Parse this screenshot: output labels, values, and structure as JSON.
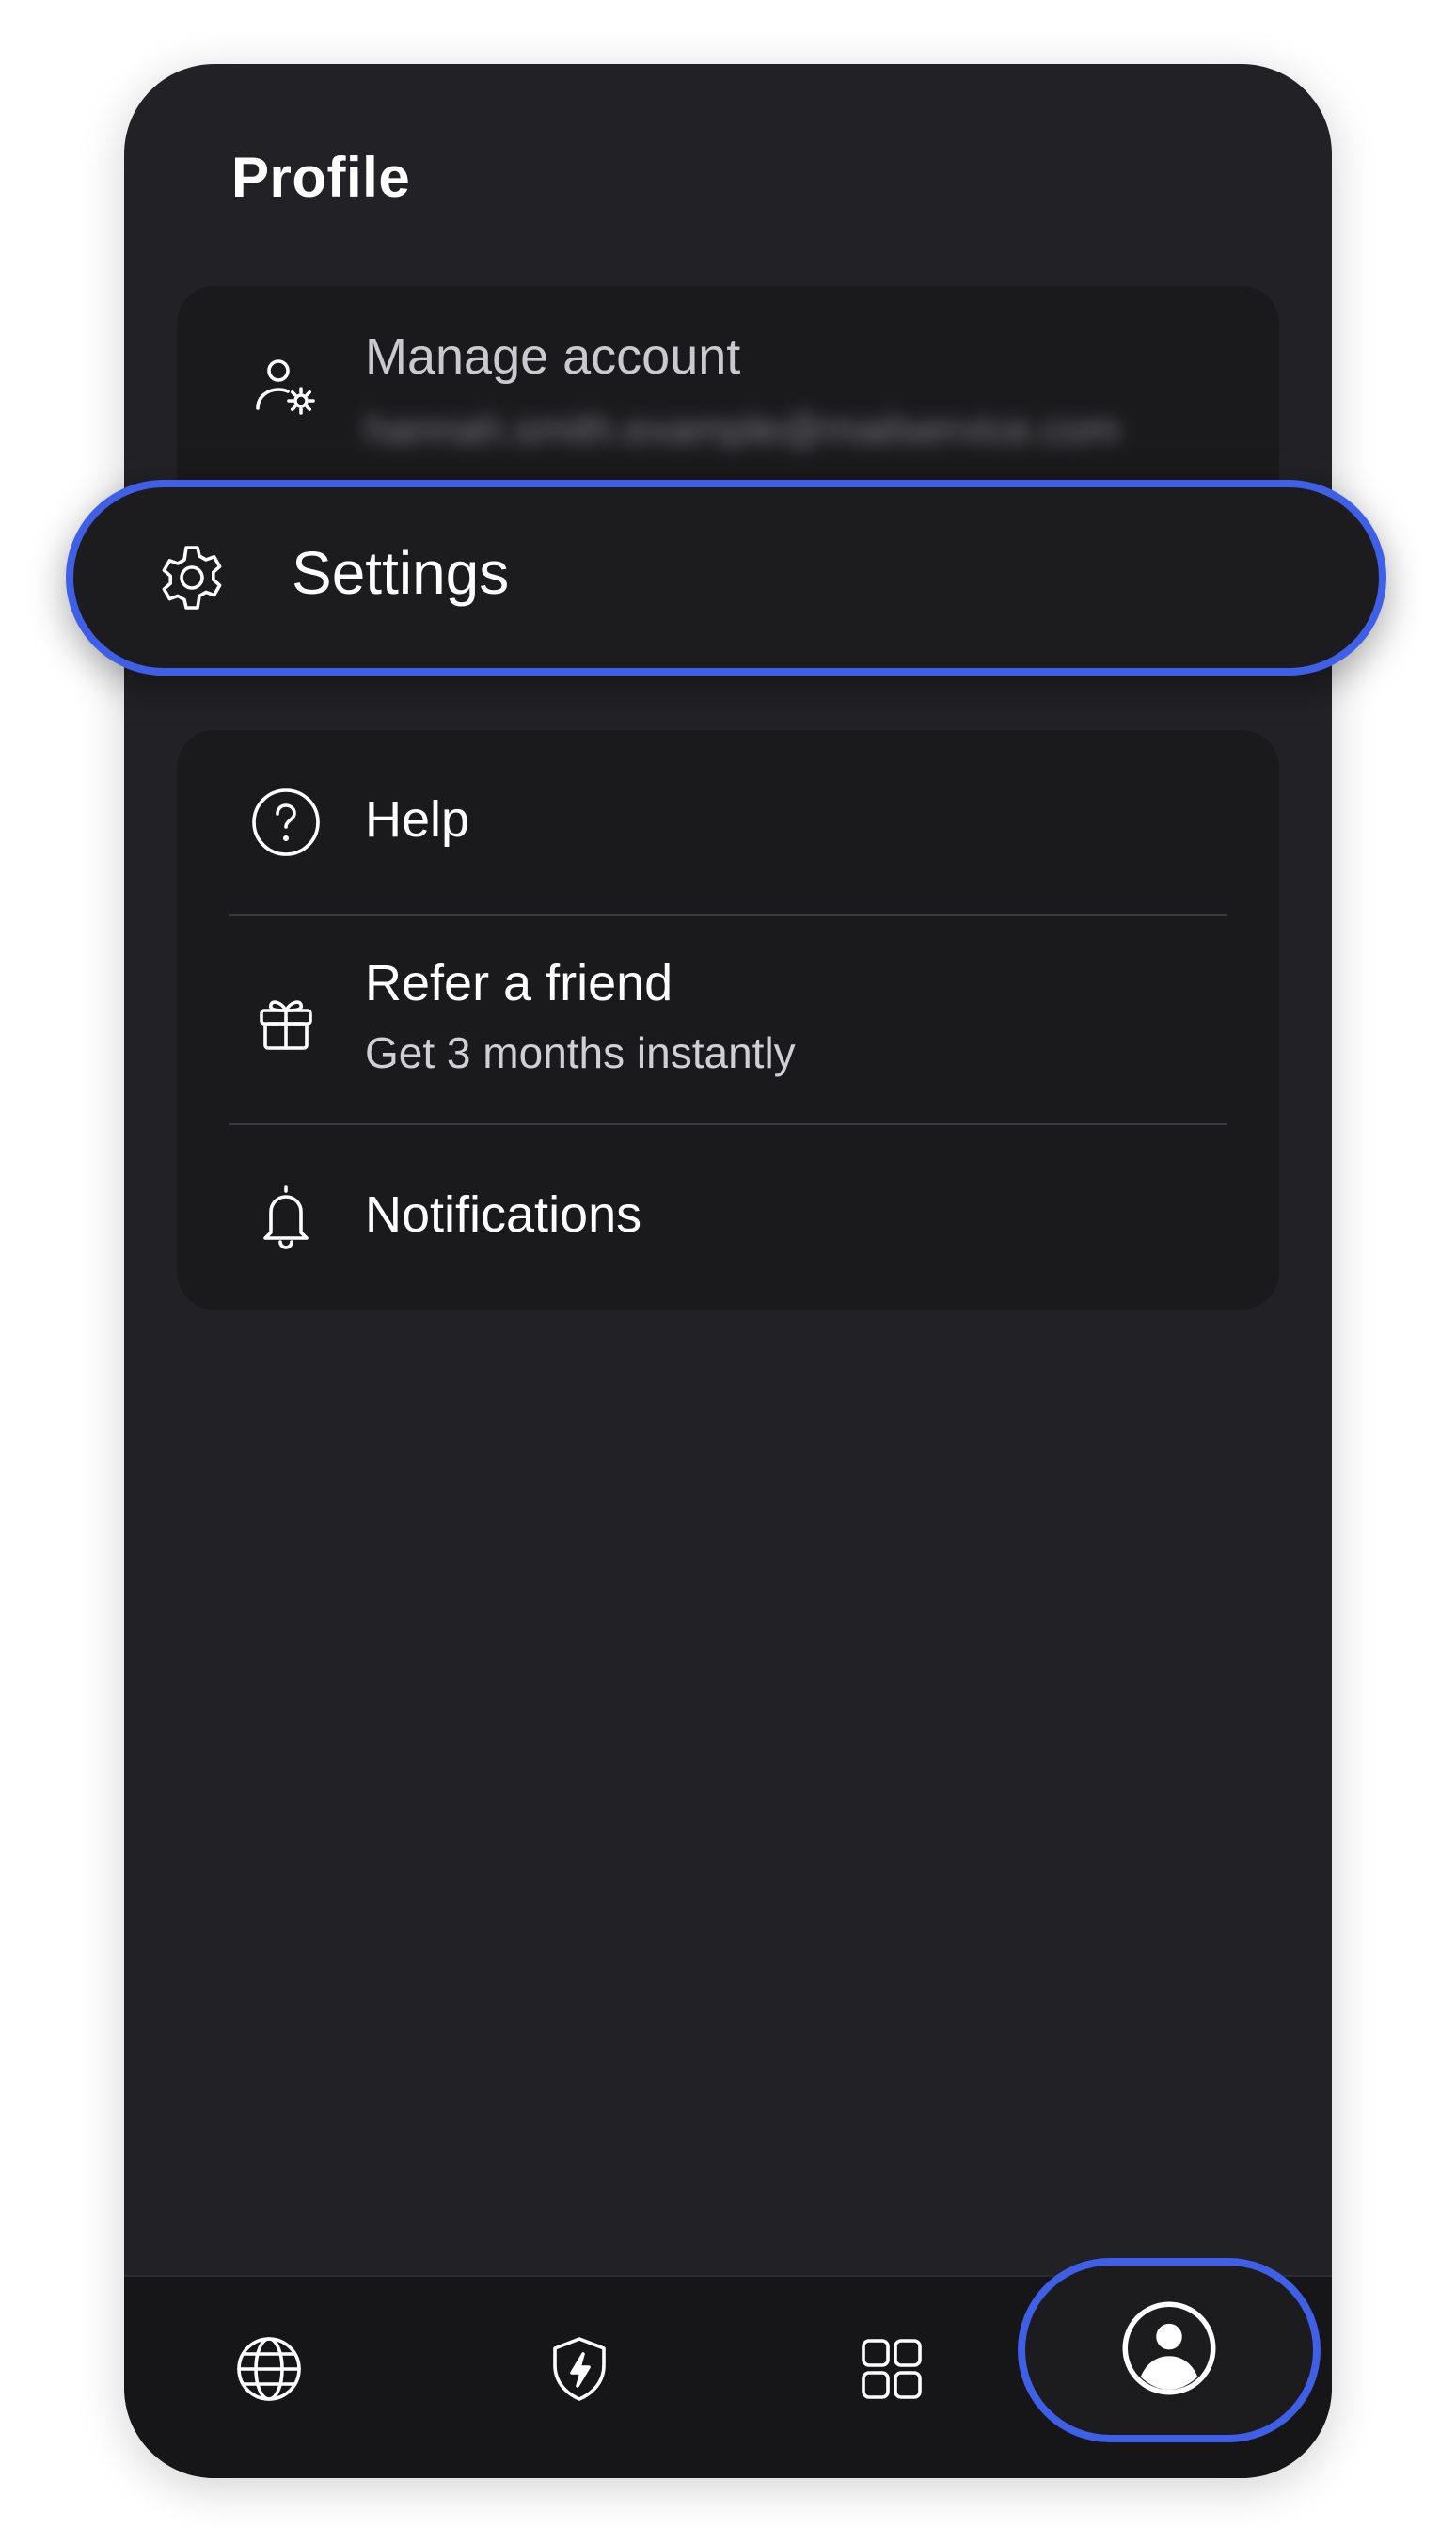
{
  "page": {
    "title": "Profile"
  },
  "account_card": {
    "label": "Manage account",
    "email_redacted": "hannah.smith.example@mailservice.com",
    "icon": "user-gear-icon"
  },
  "settings_row": {
    "label": "Settings",
    "icon": "gear-icon",
    "highlight_color": "#3f5fe6"
  },
  "menu": {
    "items": [
      {
        "label": "Help",
        "icon": "help-circle-icon"
      },
      {
        "label": "Refer a friend",
        "sublabel": "Get 3 months instantly",
        "icon": "gift-icon"
      },
      {
        "label": "Notifications",
        "icon": "bell-icon"
      }
    ]
  },
  "bottom_nav": {
    "items": [
      {
        "name": "globe",
        "icon": "globe-icon"
      },
      {
        "name": "shield",
        "icon": "shield-bolt-icon"
      },
      {
        "name": "apps",
        "icon": "grid-icon"
      },
      {
        "name": "profile",
        "icon": "profile-icon",
        "active": true
      }
    ]
  },
  "colors": {
    "background": "#212126",
    "card": "#1a1a1d",
    "accent": "#3f5fe6",
    "text": "#ffffff"
  }
}
